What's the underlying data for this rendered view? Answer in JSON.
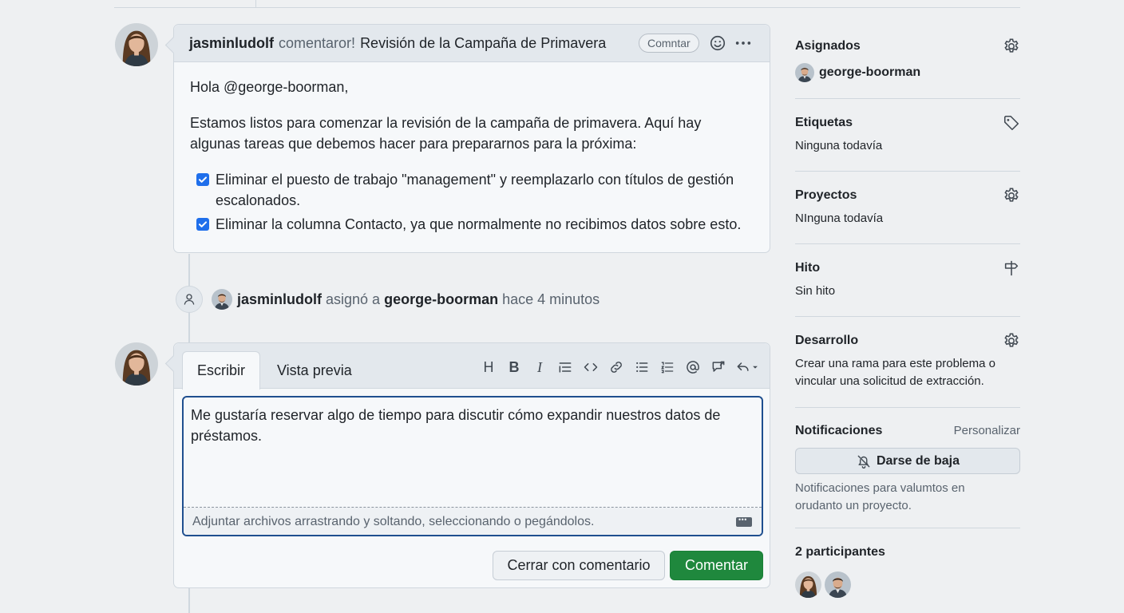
{
  "comment": {
    "author": "jasminludolf",
    "action": "comentaror!",
    "title": "Revisión de la Campaña de Primavera",
    "badge": "Comntar",
    "greeting": "Hola @george-boorman,",
    "intro": "Estamos listos para comenzar la revisión de la campaña de primavera. Aquí hay algunas tareas que debemos hacer para prepararnos para la próxima:",
    "tasks": [
      "Eliminar el puesto de trabajo \"management\" y reemplazarlo con títulos de gestión escalonados.",
      "Eliminar la columna Contacto, ya que normalmente no recibimos datos sobre esto."
    ]
  },
  "event": {
    "actor": "jasminludolf",
    "verb": "asignó a",
    "target": "george-boorman",
    "time": "hace 4 minutos"
  },
  "editor": {
    "tab_write": "Escribir",
    "tab_preview": "Vista previa",
    "toolbar_heading": "H",
    "toolbar_bold": "B",
    "toolbar_italic": "I",
    "text": "Me gustaría reservar algo de tiempo para discutir cómo expandir nuestros datos de préstamos.",
    "attach_hint": "Adjuntar archivos arrastrando y soltando, seleccionando o pegándolos.",
    "close_button": "Cerrar con comentario",
    "comment_button": "Comentar"
  },
  "sidebar": {
    "assignees": {
      "title": "Asignados",
      "user": "george-boorman"
    },
    "labels": {
      "title": "Etiquetas",
      "value": "Ninguna todavía"
    },
    "projects": {
      "title": "Proyectos",
      "value": "NInguna todavía"
    },
    "milestone": {
      "title": "Hito",
      "value": "Sin hito"
    },
    "development": {
      "title": "Desarrollo",
      "value": "Crear una rama para este problema o vincular una solicitud de extracción."
    },
    "notifications": {
      "title": "Notificaciones",
      "customize": "Personalizar",
      "button": "Darse de baja",
      "note": "Notificaciones para valumtos en orudanto un proyecto."
    },
    "participants": {
      "title": "2 participantes"
    }
  },
  "colors": {
    "accent_blue": "#1f6feb",
    "primary_green": "#1f883d",
    "border": "#d0d7de"
  }
}
